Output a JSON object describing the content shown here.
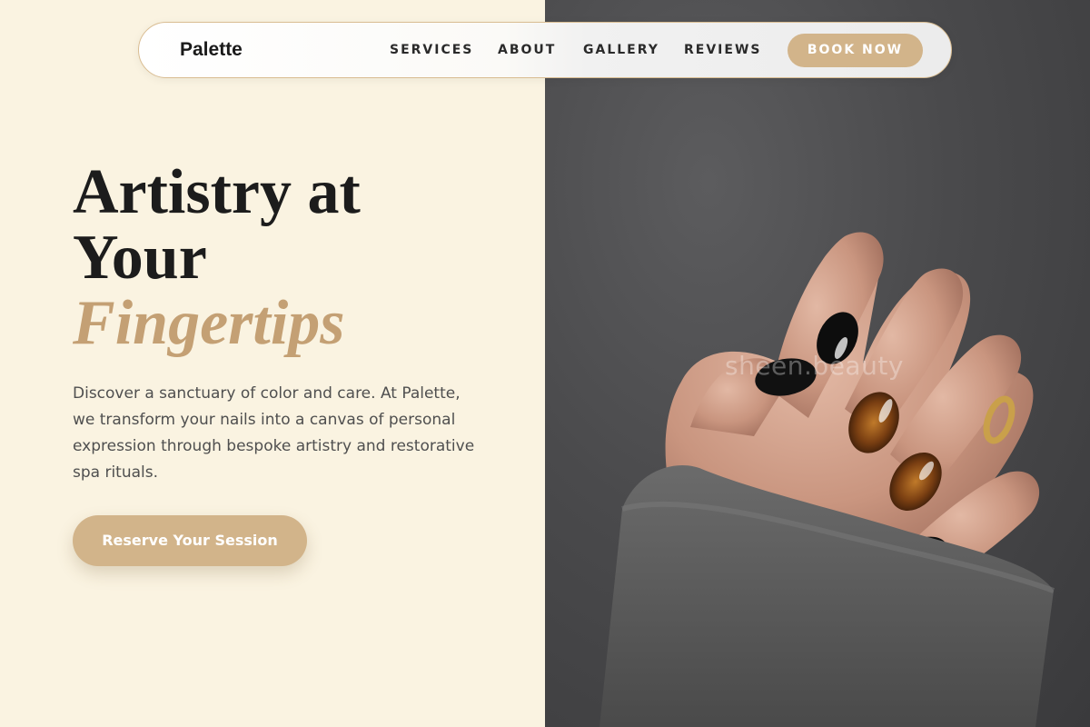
{
  "brand": {
    "name": "Palette"
  },
  "nav": {
    "links": [
      "SERVICES",
      "ABOUT",
      "GALLERY",
      "REVIEWS"
    ],
    "cta_label": "BOOK NOW"
  },
  "hero": {
    "title_line_1": "Artistry at",
    "title_line_2": "Your",
    "title_accent": "Fingertips",
    "description": "Discover a sanctuary of color and care. At Palette, we transform your nails into a canvas of personal expression through bespoke artistry and restorative spa rituals.",
    "cta_label": "Reserve Your Session"
  },
  "image": {
    "watermark": "sheen.beauty",
    "subject": "manicured hand with black and tortoiseshell nails in grey knit sweater"
  },
  "colors": {
    "background_cream": "#faf3e1",
    "accent_tan": "#d2b48a",
    "title_accent": "#c4a074",
    "text_dark": "#1c1c1c"
  }
}
